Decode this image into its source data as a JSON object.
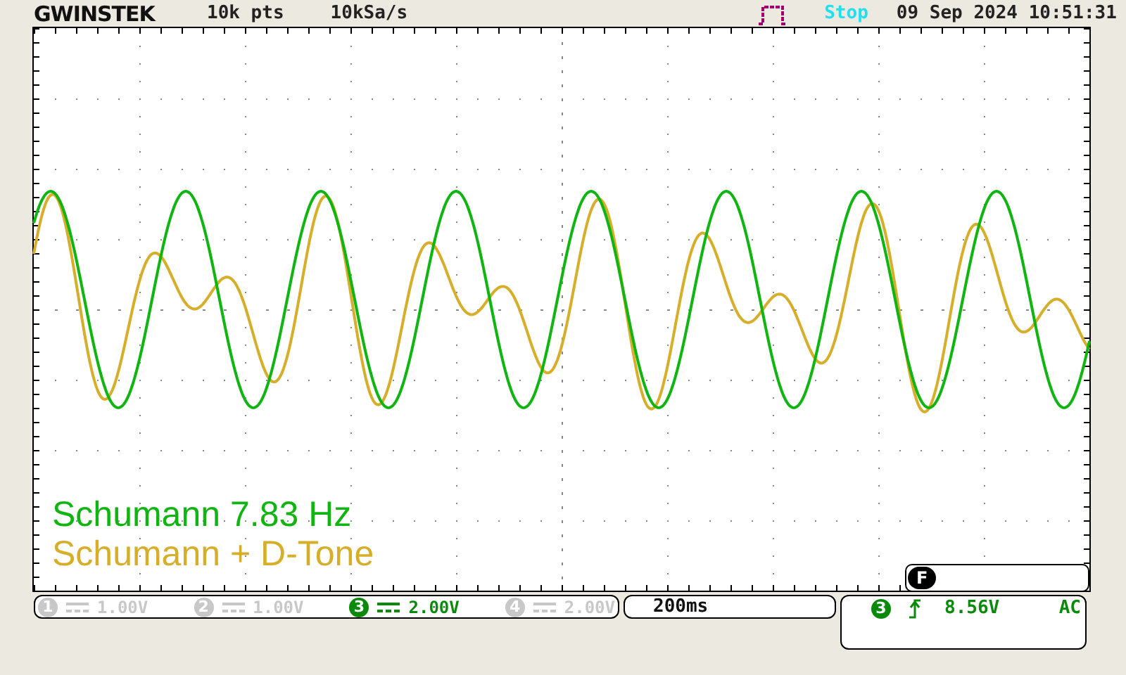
{
  "header": {
    "logo": "GWINSTEK",
    "record_length": "10k pts",
    "sample_rate": "10kSa/s",
    "run_state": "Stop",
    "datetime": "09 Sep 2024 10:51:31"
  },
  "legend": [
    {
      "text": "Schumann 7.83 Hz",
      "color": "#11b511"
    },
    {
      "text": "Schumann + D-Tone",
      "color": "#d6ae2a"
    }
  ],
  "function_tab": {
    "label": "F"
  },
  "channels": [
    {
      "number": "1",
      "scale": "1.00V",
      "active": false
    },
    {
      "number": "2",
      "scale": "1.00V",
      "active": false
    },
    {
      "number": "3",
      "scale": "2.00V",
      "active": true
    },
    {
      "number": "4",
      "scale": "2.00V",
      "active": false
    }
  ],
  "timebase": "200ms",
  "trigger": {
    "source": "3",
    "level": "8.56V",
    "coupling": "AC"
  }
}
